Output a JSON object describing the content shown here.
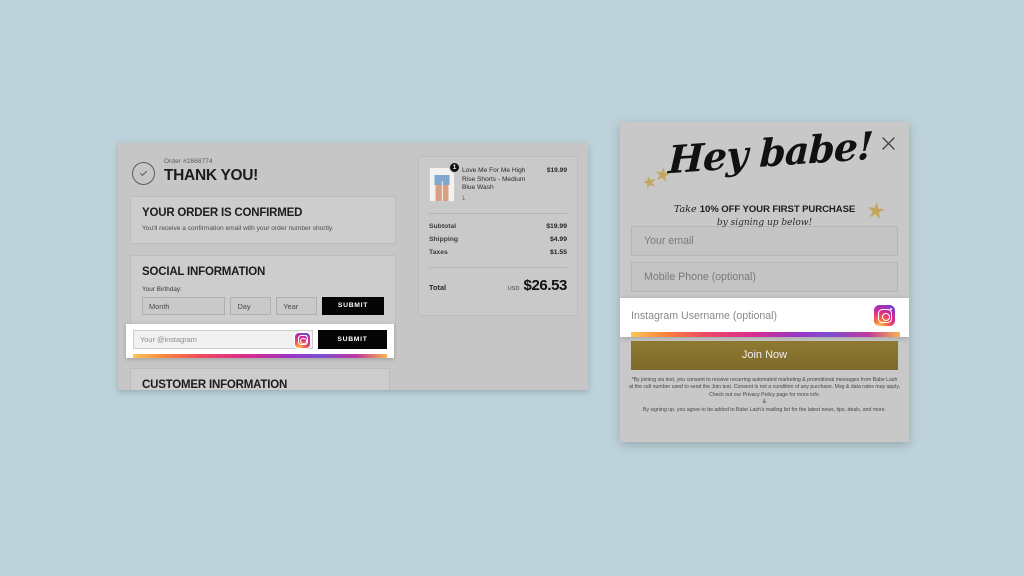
{
  "page": {
    "background_color": "#bdd2da"
  },
  "order_panel": {
    "order_number_label": "Order #2868774",
    "thank_you_title": "THANK YOU!",
    "check_icon": "check-circle-icon",
    "confirmed_card": {
      "title": "YOUR ORDER IS CONFIRMED",
      "subtitle": "You'll receive a confirmation email with your order number shortly."
    },
    "social_card": {
      "title": "SOCIAL INFORMATION",
      "birthday_label": "Your Birthday:",
      "month_placeholder": "Month",
      "day_placeholder": "Day",
      "year_placeholder": "Year",
      "submit_label": "SUBMIT"
    },
    "instagram_row": {
      "placeholder": "Your @instagram",
      "submit_label": "SUBMIT",
      "icon": "instagram-icon",
      "highlighted": true
    },
    "customer_card": {
      "title": "CUSTOMER INFORMATION"
    },
    "summary": {
      "item": {
        "name": "Love Me For Me High Rise Shorts - Medium Blue Wash",
        "quantity": "1",
        "badge_count": "1",
        "price": "$19.99"
      },
      "rows": [
        {
          "label": "Subtotal",
          "value": "$19.99"
        },
        {
          "label": "Shipping",
          "value": "$4.99"
        },
        {
          "label": "Taxes",
          "value": "$1.55"
        }
      ],
      "total_label": "Total",
      "total_currency": "USD",
      "total_value": "$26.53"
    }
  },
  "modal": {
    "close_icon": "close-icon",
    "headline": "Hey babe!",
    "offer_prefix": "Take ",
    "offer_bold": "10% OFF YOUR FIRST PURCHASE",
    "offer_sub": "by signing up below!",
    "star_icon": "star-icon",
    "email_placeholder": "Your email",
    "phone_placeholder": "Mobile Phone (optional)",
    "instagram_placeholder": "Instagram Username (optional)",
    "instagram_icon": "instagram-icon",
    "join_label": "Join Now",
    "legal_text": "*By joining via text, you consent to receive recurring automated marketing & promotional messages from Babe Lash at the cell number used to send the Join text. Consent is not a condition of any purchase. Msg & data rates may apply. Check out our Privacy Policy page for more info.",
    "legal_amp": "&",
    "legal_text2": "By signing up, you agree to be added to Babe Lash's mailing list for the latest news, tips, deals, and more."
  }
}
